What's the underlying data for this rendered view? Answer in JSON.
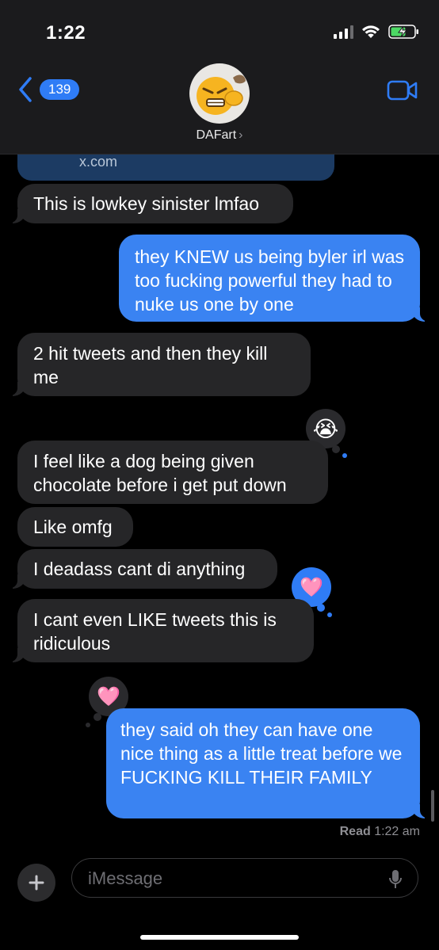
{
  "status_bar": {
    "time": "1:22"
  },
  "nav": {
    "back_count": "139",
    "contact_name": "DAFart",
    "contact_chevron": "›"
  },
  "link_preview": {
    "domain": "x.com"
  },
  "messages": [
    {
      "text": "This is lowkey sinister lmfao"
    },
    {
      "text": "they KNEW us being byler irl was too fucking powerful they had to nuke us one by one"
    },
    {
      "text": "2 hit tweets and then they kill me"
    },
    {
      "text": "I feel like a dog being given chocolate before i get put down"
    },
    {
      "text": "Like omfg"
    },
    {
      "text": "I deadass cant di anything"
    },
    {
      "text": "I cant even LIKE tweets this is ridiculous"
    },
    {
      "text": "they said oh they can have one nice thing as a little treat before we FUCKING KILL THEIR FAMILY"
    }
  ],
  "reactions": {
    "crying": "😭",
    "pink_heart": "🩷",
    "heart": "🩷"
  },
  "receipt": {
    "label": "Read",
    "time": "1:22 am"
  },
  "composer": {
    "placeholder": "iMessage",
    "plus": "+"
  },
  "colors": {
    "incoming": "#262628",
    "outgoing": "#3a83f2",
    "accent": "#2f7cf6"
  }
}
